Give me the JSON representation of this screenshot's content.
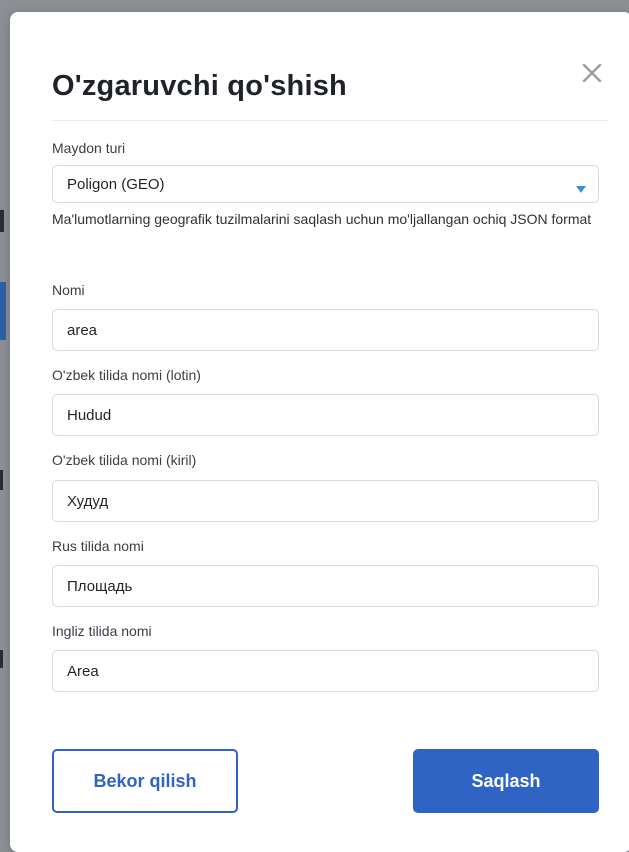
{
  "modal": {
    "title": "O'zgaruvchi qo'shish",
    "close_icon": "close-icon"
  },
  "form": {
    "field_type": {
      "label": "Maydon turi",
      "value": "Poligon (GEO)",
      "help": "Ma'lumotlarning geografik tuzilmalarini saqlash uchun mo'ljallangan ochiq JSON format"
    },
    "name": {
      "label": "Nomi",
      "value": "area"
    },
    "name_uz_latin": {
      "label": "O'zbek tilida nomi (lotin)",
      "value": "Hudud"
    },
    "name_uz_cyrillic": {
      "label": "O'zbek tilida nomi (kiril)",
      "value": "Худуд"
    },
    "name_ru": {
      "label": "Rus tilida nomi",
      "value": "Площадь"
    },
    "name_en": {
      "label": "Ingliz tilida nomi",
      "value": "Area"
    }
  },
  "actions": {
    "cancel_label": "Bekor qilish",
    "save_label": "Saqlash"
  },
  "colors": {
    "accent": "#2f63c4",
    "select_arrow": "#3f8fd1"
  }
}
